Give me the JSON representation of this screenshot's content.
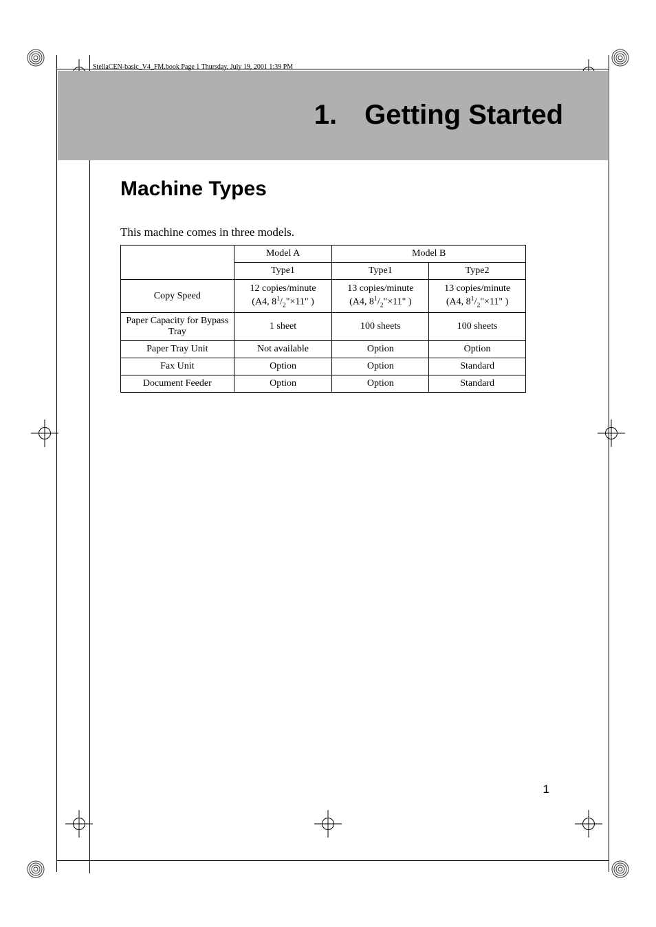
{
  "header": "StellaCEN-basic_V4_FM.book  Page 1  Thursday, July 19, 2001  1:39 PM",
  "chapter_title": "1. Getting Started",
  "section_title": "Machine Types",
  "intro": "This machine comes in three models.",
  "page_number": "1",
  "table": {
    "headers": {
      "blank": "",
      "model_a": "Model A",
      "model_b": "Model B",
      "type1_a": "Type1",
      "type1_b": "Type1",
      "type2_b": "Type2"
    },
    "rows": [
      {
        "label": "Copy Speed",
        "a": "12 copies/minute\n(A4, 8¹/₂\"×11\" )",
        "b1": "13 copies/minute\n(A4, 8¹/₂\"×11\" )",
        "b2": "13 copies/minute\n(A4, 8¹/₂\"×11\" )"
      },
      {
        "label": "Paper Capacity for Bypass Tray",
        "a": "1 sheet",
        "b1": "100 sheets",
        "b2": "100 sheets"
      },
      {
        "label": "Paper Tray Unit",
        "a": "Not available",
        "b1": "Option",
        "b2": "Option"
      },
      {
        "label": "Fax Unit",
        "a": "Option",
        "b1": "Option",
        "b2": "Standard"
      },
      {
        "label": "Document Feeder",
        "a": "Option",
        "b1": "Option",
        "b2": "Standard"
      }
    ]
  },
  "chart_data": {
    "type": "table",
    "title": "Machine Types",
    "columns": [
      "",
      "Model A / Type1",
      "Model B / Type1",
      "Model B / Type2"
    ],
    "rows": [
      [
        "Copy Speed",
        "12 copies/minute (A4, 8 1/2\"×11\")",
        "13 copies/minute (A4, 8 1/2\"×11\")",
        "13 copies/minute (A4, 8 1/2\"×11\")"
      ],
      [
        "Paper Capacity for Bypass Tray",
        "1 sheet",
        "100 sheets",
        "100 sheets"
      ],
      [
        "Paper Tray Unit",
        "Not available",
        "Option",
        "Option"
      ],
      [
        "Fax Unit",
        "Option",
        "Option",
        "Standard"
      ],
      [
        "Document Feeder",
        "Option",
        "Option",
        "Standard"
      ]
    ]
  }
}
